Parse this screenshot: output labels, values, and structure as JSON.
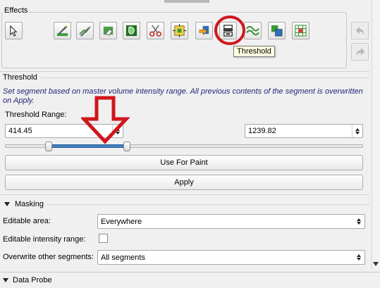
{
  "effects": {
    "title": "Effects",
    "tools": [
      {
        "icon": "select-arrow-icon"
      },
      {
        "icon": "paint-icon"
      },
      {
        "icon": "draw-icon"
      },
      {
        "icon": "erase-icon"
      },
      {
        "icon": "level-tracing-icon"
      },
      {
        "icon": "scissors-icon"
      },
      {
        "icon": "margin-icon"
      },
      {
        "icon": "hollow-icon"
      },
      {
        "icon": "threshold-icon"
      },
      {
        "icon": "smoothing-icon"
      },
      {
        "icon": "islands-icon"
      },
      {
        "icon": "logical-operators-icon"
      }
    ],
    "undo_icon": "undo-icon",
    "redo_icon": "redo-icon",
    "tooltip": "Threshold",
    "highlight_color": "#d0161c"
  },
  "threshold": {
    "section_title": "Threshold",
    "description": "Set segment based on master volume intensity range. All previous contents of the segment is overwritten on Apply.",
    "range_label": "Threshold Range:",
    "min_value": "414.45",
    "max_value": "1239.82",
    "use_for_paint_label": "Use For Paint",
    "apply_label": "Apply",
    "slider_fill_color": "#3c7fc2"
  },
  "masking": {
    "title": "Masking",
    "editable_area_label": "Editable area:",
    "editable_area_value": "Everywhere",
    "intensity_range_label": "Editable intensity range:",
    "intensity_range_checked": false,
    "overwrite_label": "Overwrite other segments:",
    "overwrite_value": "All segments"
  },
  "data_probe": {
    "title": "Data Probe"
  },
  "annotation": {
    "arrow_color": "#d0161c"
  }
}
